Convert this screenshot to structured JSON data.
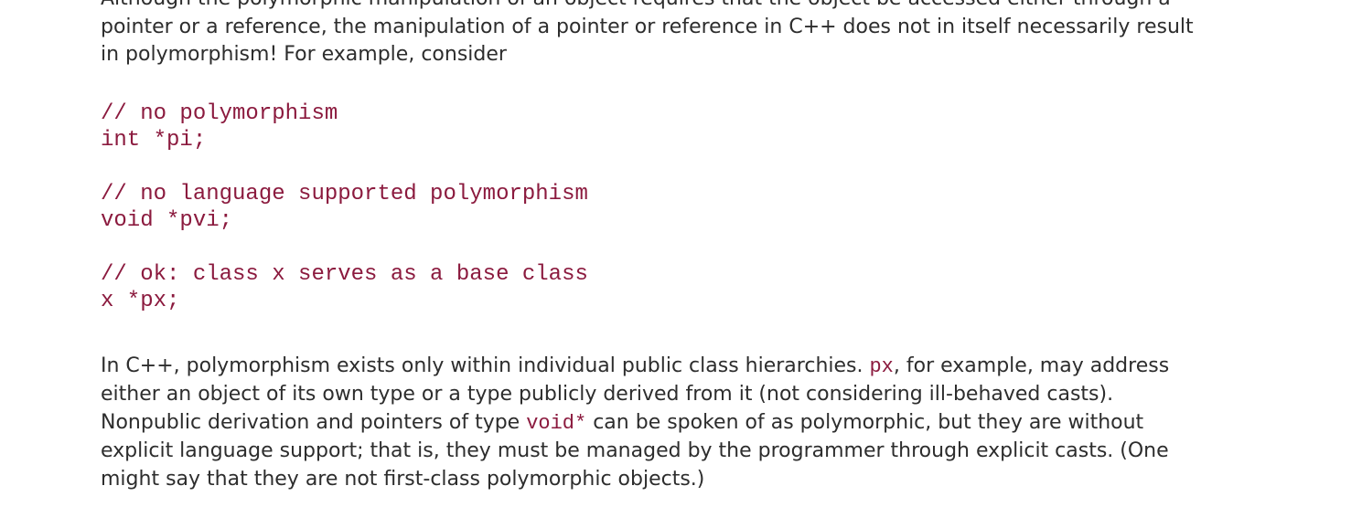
{
  "intro": {
    "line1": "Although the polymorphic manipulation of an object requires that the object be accessed either through a",
    "line2": "pointer or a reference, the manipulation of a pointer or reference in C++ does not in itself necessarily result",
    "line3": "in polymorphism! For example, consider"
  },
  "code_blocks": [
    {
      "comment": "// no polymorphism",
      "statement": "int *pi;"
    },
    {
      "comment": "// no language supported polymorphism",
      "statement": "void *pvi;"
    },
    {
      "comment": "// ok: class x serves as a base class",
      "statement": "x *px;"
    }
  ],
  "explanation": {
    "line1_a": "In C++, polymorphism exists only within individual public class hierarchies. ",
    "line1_code": "px",
    "line1_b": ", for example, may address",
    "line2": "either an object of its own type or a type publicly derived from it (not considering ill-behaved casts).",
    "line3_a": "Nonpublic derivation and pointers of type ",
    "line3_code": "void*",
    "line3_b": " can be spoken of as polymorphic, but they are without",
    "line4": "explicit language support; that is, they must be managed by the programmer through explicit casts. (One",
    "line5": "might say that they are not first-class polymorphic objects.)"
  }
}
